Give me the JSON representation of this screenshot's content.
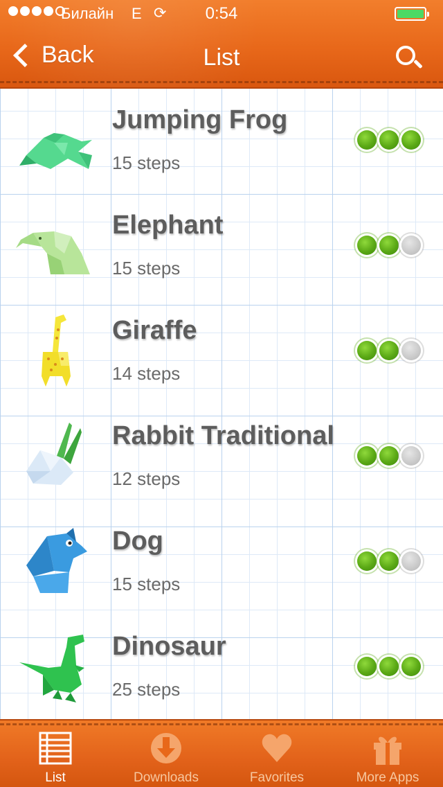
{
  "status_bar": {
    "carrier": "Билайн",
    "network": "E",
    "time": "0:54",
    "signal_bars_filled": 4,
    "signal_bars_total": 5,
    "battery_level": 1.0
  },
  "navbar": {
    "back_label": "Back",
    "title": "List"
  },
  "items": [
    {
      "title": "Jumping Frog",
      "steps": "15 steps",
      "rating": 3,
      "rating_max": 3,
      "icon": "origami-frog-icon"
    },
    {
      "title": "Elephant",
      "steps": "15 steps",
      "rating": 2,
      "rating_max": 3,
      "icon": "origami-elephant-icon"
    },
    {
      "title": "Giraffe",
      "steps": "14 steps",
      "rating": 2,
      "rating_max": 3,
      "icon": "origami-giraffe-icon"
    },
    {
      "title": "Rabbit Traditional",
      "steps": "12 steps",
      "rating": 2,
      "rating_max": 3,
      "icon": "origami-rabbit-icon"
    },
    {
      "title": "Dog",
      "steps": "15 steps",
      "rating": 2,
      "rating_max": 3,
      "icon": "origami-dog-icon"
    },
    {
      "title": "Dinosaur",
      "steps": "25 steps",
      "rating": 3,
      "rating_max": 3,
      "icon": "origami-dinosaur-icon"
    }
  ],
  "tabs": [
    {
      "label": "List",
      "icon": "list-icon",
      "active": true
    },
    {
      "label": "Downloads",
      "icon": "download-icon",
      "active": false
    },
    {
      "label": "Favorites",
      "icon": "heart-icon",
      "active": false
    },
    {
      "label": "More Apps",
      "icon": "gift-icon",
      "active": false
    }
  ],
  "colors": {
    "leather": "#e8681a",
    "grid_line": "#b9d2ee",
    "rating_on": "#5aa815",
    "rating_off": "#c9c9c9",
    "title_text": "#5d5d5d"
  }
}
